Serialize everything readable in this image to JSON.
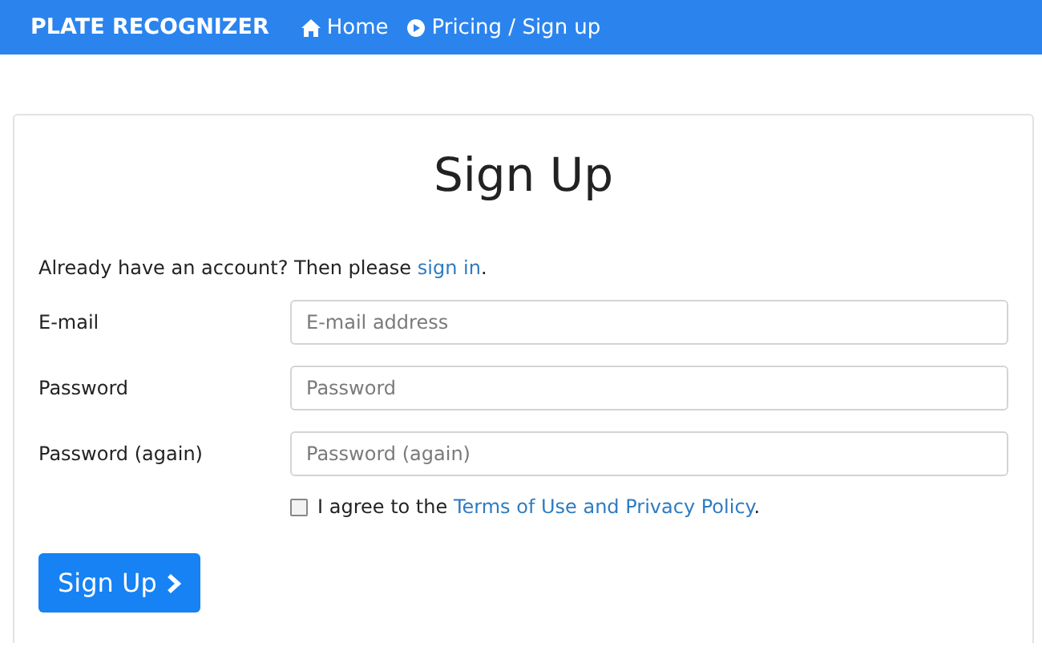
{
  "navbar": {
    "brand": "PLATE RECOGNIZER",
    "links": [
      {
        "kind": "home",
        "label": "Home"
      },
      {
        "kind": "play",
        "label": "Pricing / Sign up"
      }
    ]
  },
  "form": {
    "title": "Sign Up",
    "signin_prompt": {
      "before": "Already have an account? Then please ",
      "link": "sign in",
      "after": "."
    },
    "fields": [
      {
        "label": "E-mail",
        "placeholder": "E-mail address"
      },
      {
        "label": "Password",
        "placeholder": "Password"
      },
      {
        "label": "Password (again)",
        "placeholder": "Password (again)"
      }
    ],
    "agreement": {
      "checked": false,
      "before": "I agree to the ",
      "link": "Terms of Use and Privacy Policy",
      "after": "."
    },
    "submit": {
      "label": "Sign Up"
    }
  }
}
